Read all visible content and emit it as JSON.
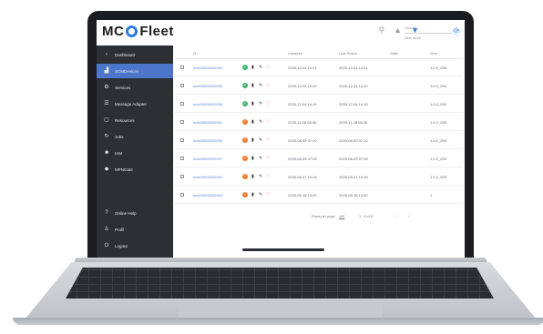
{
  "brand": {
    "mc": "MC",
    "fleet": "Fleet",
    "accent": "#2b7be4"
  },
  "topbar": {
    "label": "View more",
    "search_placeholder": "Search...",
    "action_icon": "refresh"
  },
  "sidebar": {
    "back_label": "Dashboard",
    "items": [
      {
        "label": "SCMDevices",
        "icon": "device"
      },
      {
        "label": "Services",
        "icon": "services"
      },
      {
        "label": "Message Adapter",
        "icon": "message"
      },
      {
        "label": "Resources",
        "icon": "resources"
      },
      {
        "label": "Jobs",
        "icon": "jobs"
      },
      {
        "label": "IAM",
        "icon": "users"
      },
      {
        "label": "MPNGate",
        "icon": "gate"
      }
    ],
    "bottom": [
      {
        "label": "Online Help",
        "icon": "help"
      },
      {
        "label": "Profil",
        "icon": "user"
      },
      {
        "label": "Logout",
        "icon": "power"
      }
    ],
    "active_color": "#4b76c9"
  },
  "table": {
    "headers": [
      "Id",
      "Lastseen",
      "Last Status",
      "State",
      "Vers."
    ],
    "rows": [
      {
        "id": "mcb00000002900",
        "status": "green",
        "lastseen": "2025-12-04 14:21",
        "status_time": "2025-12-04 14:21",
        "version": "1.0.0_295"
      },
      {
        "id": "mcb00000002903",
        "status": "green",
        "lastseen": "2025-12-04 14:20",
        "status_time": "2025-12-04 14:20",
        "version": "1.0.0_295"
      },
      {
        "id": "mcb00000002906",
        "status": "green",
        "lastseen": "2025-12-04 14:19",
        "status_time": "2025-12-04 14:19",
        "version": "1.0.0_295"
      },
      {
        "id": "mcb00000002901",
        "status": "orange",
        "lastseen": "2025-11-28 08:36",
        "status_time": "2025-11-28 08:36",
        "version": "1.0.0_295"
      },
      {
        "id": "mcb00000002905",
        "status": "orange",
        "lastseen": "2025-08-09 07:10",
        "status_time": "2025-08-09 07:10",
        "version": "1.0.0_295"
      },
      {
        "id": "mcb00000002907",
        "status": "orange",
        "lastseen": "2025-08-29 07:05",
        "status_time": "2025-08-29 07:05",
        "version": "1.0.0_295"
      },
      {
        "id": "mcb00000002902",
        "status": "orange",
        "lastseen": "2025-08-21 14:18",
        "status_time": "2025-08-21 14:18",
        "version": "1.0.0_295"
      },
      {
        "id": "mcb00000002904",
        "status": "orange",
        "lastseen": "2025-08-18 13:52",
        "status_time": "2025-08-18 13:52",
        "version": "1"
      }
    ],
    "status_colors": {
      "green": "#3cb371",
      "orange": "#f07a2a"
    }
  },
  "pager": {
    "rows_label": "Rows per page:",
    "rows_value": "100",
    "range": "1 - 8 of 8"
  }
}
